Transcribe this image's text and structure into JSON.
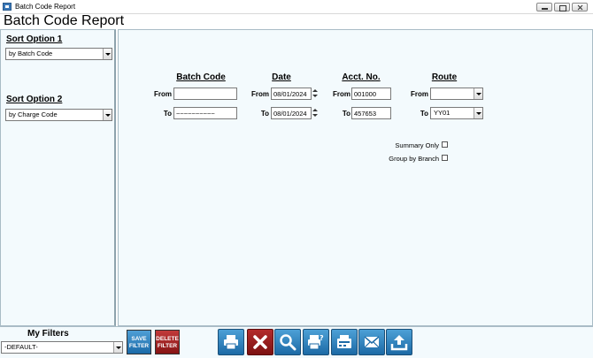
{
  "window": {
    "title": "Batch Code Report"
  },
  "header": {
    "title": "Batch Code Report"
  },
  "sort": {
    "option1_label": "Sort Option 1",
    "option1_value": "by Batch Code",
    "option2_label": "Sort Option 2",
    "option2_value": "by Charge Code"
  },
  "criteria": {
    "columns": {
      "batch_code": "Batch Code",
      "date": "Date",
      "acct_no": "Acct. No.",
      "route": "Route"
    },
    "from_label": "From",
    "to_label": "To",
    "batch_code_from": "",
    "batch_code_to": "~~~~~~~~~~",
    "date_from": "08/01/2024",
    "date_to": "08/01/2024",
    "acct_from": "001000",
    "acct_to": "457653",
    "route_from": "",
    "route_to": "YY01"
  },
  "options": {
    "summary_only": "Summary Only",
    "group_by_branch": "Group by Branch"
  },
  "filters": {
    "label": "My Filters",
    "selected": "-DEFAULT-",
    "save_label_1": "SAVE",
    "save_label_2": "FILTER",
    "delete_label_1": "DELETE",
    "delete_label_2": "FILTER"
  },
  "toolbar": {
    "icons": [
      "print-icon",
      "close-icon",
      "search-icon",
      "print-preview-icon",
      "fax-icon",
      "email-icon",
      "export-icon"
    ]
  },
  "colors": {
    "panel_bg": "#f3fafd",
    "button_blue": "#1c6aa6",
    "button_red": "#861414"
  }
}
